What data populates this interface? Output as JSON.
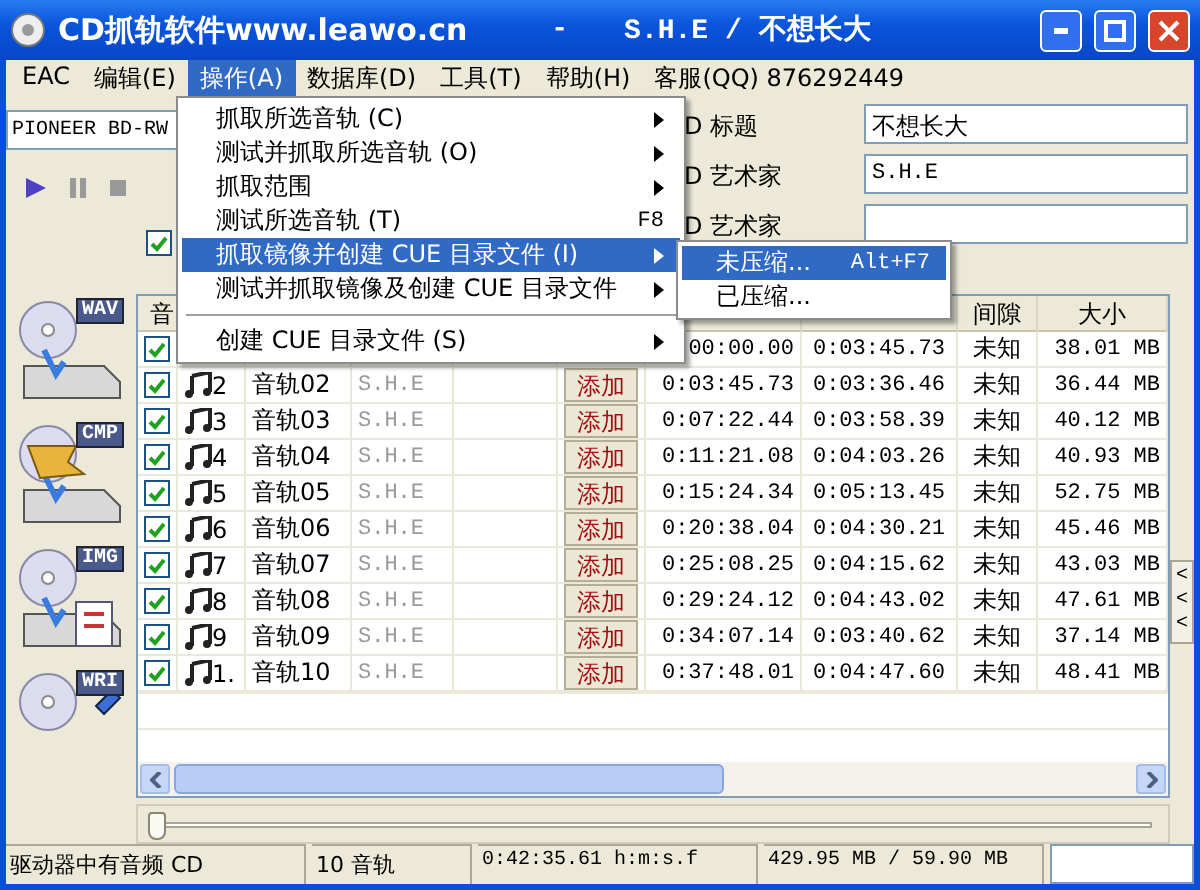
{
  "window": {
    "title": "CD抓轨软件www.leawo.cn",
    "separator": "-",
    "album_title": "S.H.E / 不想长大"
  },
  "menu_bar": [
    {
      "label": "EAC",
      "selected": false
    },
    {
      "label": "编辑(E)",
      "selected": false
    },
    {
      "label": "操作(A)",
      "selected": true
    },
    {
      "label": "数据库(D)",
      "selected": false
    },
    {
      "label": "工具(T)",
      "selected": false
    },
    {
      "label": "帮助(H)",
      "selected": false
    },
    {
      "label": "客服(QQ) 876292449",
      "selected": false
    }
  ],
  "drive": {
    "value": "PIONEER BD-RW"
  },
  "cd_fields": [
    {
      "label": "D 标题",
      "value": "不想长大"
    },
    {
      "label": "D 艺术家",
      "value": "S.H.E"
    },
    {
      "label": "D 艺术家"
    }
  ],
  "select_all": {
    "checked": true
  },
  "side_tools": [
    {
      "label": "WAV",
      "kind": "wav"
    },
    {
      "label": "CMP",
      "kind": "cmp"
    },
    {
      "label": "IMG",
      "kind": "img"
    },
    {
      "label": "WRI",
      "kind": "wri"
    }
  ],
  "table": {
    "headers": {
      "track": "音",
      "gap": "间隙",
      "size": "大小"
    },
    "rows": [
      {
        "checked": true,
        "start": "00:00.00",
        "length": "0:03:45.73",
        "gap": "未知",
        "size": "38.01 MB"
      },
      {
        "checked": true,
        "number": "2",
        "title": "音轨02",
        "artist": "S.H.E",
        "button": "添加",
        "start": "0:03:45.73",
        "length": "0:03:36.46",
        "gap": "未知",
        "size": "36.44 MB"
      },
      {
        "checked": true,
        "number": "3",
        "title": "音轨03",
        "artist": "S.H.E",
        "button": "添加",
        "start": "0:07:22.44",
        "length": "0:03:58.39",
        "gap": "未知",
        "size": "40.12 MB"
      },
      {
        "checked": true,
        "number": "4",
        "title": "音轨04",
        "artist": "S.H.E",
        "button": "添加",
        "start": "0:11:21.08",
        "length": "0:04:03.26",
        "gap": "未知",
        "size": "40.93 MB"
      },
      {
        "checked": true,
        "number": "5",
        "title": "音轨05",
        "artist": "S.H.E",
        "button": "添加",
        "start": "0:15:24.34",
        "length": "0:05:13.45",
        "gap": "未知",
        "size": "52.75 MB"
      },
      {
        "checked": true,
        "number": "6",
        "title": "音轨06",
        "artist": "S.H.E",
        "button": "添加",
        "start": "0:20:38.04",
        "length": "0:04:30.21",
        "gap": "未知",
        "size": "45.46 MB"
      },
      {
        "checked": true,
        "number": "7",
        "title": "音轨07",
        "artist": "S.H.E",
        "button": "添加",
        "start": "0:25:08.25",
        "length": "0:04:15.62",
        "gap": "未知",
        "size": "43.03 MB"
      },
      {
        "checked": true,
        "number": "8",
        "title": "音轨08",
        "artist": "S.H.E",
        "button": "添加",
        "start": "0:29:24.12",
        "length": "0:04:43.02",
        "gap": "未知",
        "size": "47.61 MB"
      },
      {
        "checked": true,
        "number": "9",
        "title": "音轨09",
        "artist": "S.H.E",
        "button": "添加",
        "start": "0:34:07.14",
        "length": "0:03:40.62",
        "gap": "未知",
        "size": "37.14 MB"
      },
      {
        "checked": true,
        "number": "1.",
        "title": "音轨10",
        "artist": "S.H.E",
        "button": "添加",
        "start": "0:37:48.01",
        "length": "0:04:47.60",
        "gap": "未知",
        "size": "48.41 MB"
      }
    ]
  },
  "position_slider": {
    "level": 0
  },
  "side_toggle": {
    "label": "<<<"
  },
  "status_bar": [
    "驱动器中有音频 CD",
    "10 音轨",
    "0:42:35.61 h:m:s.f",
    "429.95 MB /  59.90 MB"
  ],
  "menu": {
    "items": [
      {
        "kind": "item",
        "label": "抓取所选音轨 (C)",
        "submenu": true,
        "selected": false
      },
      {
        "kind": "item",
        "label": "测试并抓取所选音轨 (O)",
        "submenu": true,
        "selected": false
      },
      {
        "kind": "item",
        "label": "抓取范围",
        "submenu": true,
        "selected": false
      },
      {
        "kind": "item",
        "label": "测试所选音轨 (T)",
        "shortcut": "F8",
        "submenu": false,
        "selected": false
      },
      {
        "kind": "item",
        "label": "抓取镜像并创建 CUE 目录文件 (I)",
        "submenu": true,
        "selected": true
      },
      {
        "kind": "item",
        "label": "测试并抓取镜像及创建 CUE 目录文件",
        "submenu": true,
        "selected": false
      },
      {
        "kind": "separator"
      },
      {
        "kind": "item",
        "label": "创建 CUE 目录文件 (S)",
        "submenu": true,
        "selected": false
      }
    ],
    "submenu": [
      {
        "label": "未压缩...",
        "shortcut": "Alt+F7",
        "selected": true
      },
      {
        "label": "已压缩...",
        "selected": false
      }
    ]
  }
}
